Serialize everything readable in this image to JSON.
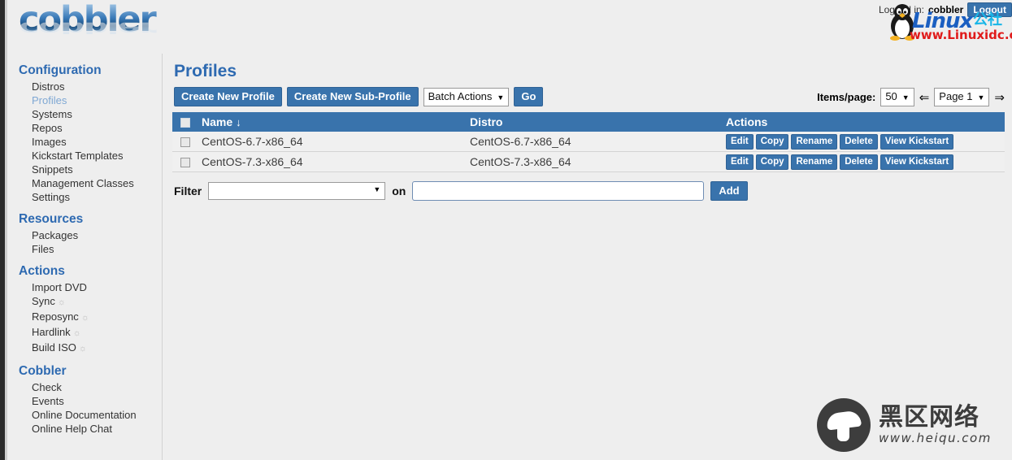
{
  "app": {
    "logo_text": "cobbler"
  },
  "session": {
    "logged_in_label": "Logged in:",
    "username": "cobbler",
    "logout_label": "Logout"
  },
  "sidebar": {
    "sections": [
      {
        "heading": "Configuration",
        "items": [
          {
            "label": "Distros",
            "active": false,
            "gear": false
          },
          {
            "label": "Profiles",
            "active": true,
            "gear": false
          },
          {
            "label": "Systems",
            "active": false,
            "gear": false
          },
          {
            "label": "Repos",
            "active": false,
            "gear": false
          },
          {
            "label": "Images",
            "active": false,
            "gear": false
          },
          {
            "label": "Kickstart Templates",
            "active": false,
            "gear": false
          },
          {
            "label": "Snippets",
            "active": false,
            "gear": false
          },
          {
            "label": "Management Classes",
            "active": false,
            "gear": false
          },
          {
            "label": "Settings",
            "active": false,
            "gear": false
          }
        ]
      },
      {
        "heading": "Resources",
        "items": [
          {
            "label": "Packages",
            "active": false,
            "gear": false
          },
          {
            "label": "Files",
            "active": false,
            "gear": false
          }
        ]
      },
      {
        "heading": "Actions",
        "items": [
          {
            "label": "Import DVD",
            "active": false,
            "gear": false
          },
          {
            "label": "Sync",
            "active": false,
            "gear": true
          },
          {
            "label": "Reposync",
            "active": false,
            "gear": true
          },
          {
            "label": "Hardlink",
            "active": false,
            "gear": true
          },
          {
            "label": "Build ISO",
            "active": false,
            "gear": true
          }
        ]
      },
      {
        "heading": "Cobbler",
        "items": [
          {
            "label": "Check",
            "active": false,
            "gear": false
          },
          {
            "label": "Events",
            "active": false,
            "gear": false
          },
          {
            "label": "Online Documentation",
            "active": false,
            "gear": false
          },
          {
            "label": "Online Help Chat",
            "active": false,
            "gear": false
          }
        ]
      }
    ]
  },
  "main": {
    "title": "Profiles",
    "toolbar": {
      "create_profile_label": "Create New Profile",
      "create_subprofile_label": "Create New Sub-Profile",
      "batch_actions_value": "Batch Actions",
      "go_label": "Go"
    },
    "pager": {
      "items_per_page_label": "Items/page:",
      "items_per_page_value": "50",
      "prev_arrow": "⇐",
      "page_value": "Page 1",
      "next_arrow": "⇒"
    },
    "table": {
      "columns": [
        "Name",
        "Distro",
        "Actions"
      ],
      "sort_column": "Name",
      "sort_arrow": "↓",
      "row_action_labels": [
        "Edit",
        "Copy",
        "Rename",
        "Delete",
        "View Kickstart"
      ],
      "rows": [
        {
          "name": "CentOS-6.7-x86_64",
          "distro": "CentOS-6.7-x86_64"
        },
        {
          "name": "CentOS-7.3-x86_64",
          "distro": "CentOS-7.3-x86_64"
        }
      ]
    },
    "filter": {
      "label": "Filter",
      "select_value": "",
      "on_label": "on",
      "text_value": "",
      "add_label": "Add"
    }
  },
  "watermarks": {
    "linux": {
      "word": "Linux",
      "cn": "公社",
      "url": "www.Linuxidc.com"
    },
    "heiqu": {
      "cn": "黑区网络",
      "url": "www.heiqu.com"
    }
  },
  "colors": {
    "accent": "#3973ac",
    "heading": "#2e6ab1",
    "active_link": "#7fa8d4",
    "page_bg": "#eeeeee",
    "row_bg": "#f0f0f0"
  }
}
